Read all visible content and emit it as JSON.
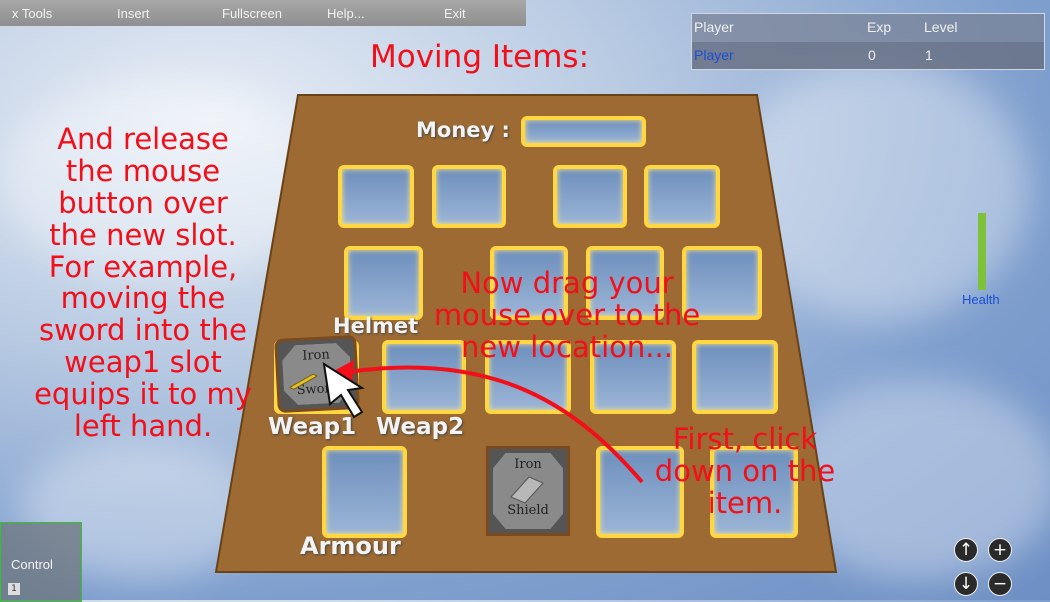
{
  "menu": {
    "tools": "x Tools",
    "insert": "Insert",
    "fullscreen": "Fullscreen",
    "help": "Help...",
    "exit": "Exit"
  },
  "player_panel": {
    "headers": [
      "Player",
      "Exp",
      "Level"
    ],
    "row": {
      "name": "Player",
      "exp": "0",
      "level": "1"
    }
  },
  "title": "Moving Items:",
  "inventory": {
    "money_label": "Money :",
    "money_value": "",
    "slot_labels": {
      "helmet": "Helmet",
      "weap1": "Weap1",
      "weap2": "Weap2",
      "armour": "Armour"
    },
    "items": {
      "sword": {
        "line1": "Iron",
        "line2": "Sword"
      },
      "shield": {
        "line1": "Iron",
        "line2": "Shield"
      }
    }
  },
  "annotations": {
    "left": [
      "And release",
      "the mouse",
      "button over",
      "the new slot.",
      "For example,",
      "moving the",
      "sword into the",
      "weap1 slot",
      "equips it to my",
      "left hand."
    ],
    "middle": [
      "Now drag your",
      "mouse over to the",
      "new location..."
    ],
    "right": [
      "First, click",
      "down on the",
      "item."
    ]
  },
  "health_label": "Health",
  "health_level": 1.0,
  "control": {
    "label": "Control",
    "badge": "1"
  },
  "icons": [
    "camera-up-icon",
    "zoom-in-icon",
    "camera-down-icon",
    "zoom-out-icon",
    "arrow-cursor-icon",
    "sword-icon",
    "shield-icon"
  ],
  "colors": {
    "annotation": "#f20f1a",
    "slot_border": "#ffd742",
    "board": "#9c6a32",
    "health": "#7ec23a"
  }
}
